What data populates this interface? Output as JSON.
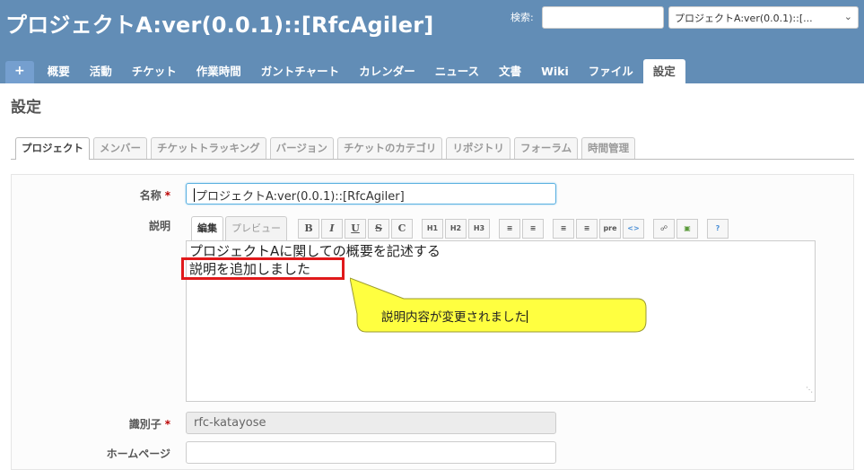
{
  "header": {
    "project_title": "プロジェクトA:ver(0.0.1)::[RfcAgiler]",
    "search_label": "検索:",
    "search_value": "",
    "project_jump": "プロジェクトA:ver(0.0.1)::[..."
  },
  "main_menu": {
    "new": "+",
    "items": [
      "概要",
      "活動",
      "チケット",
      "作業時間",
      "ガントチャート",
      "カレンダー",
      "ニュース",
      "文書",
      "Wiki",
      "ファイル",
      "設定"
    ],
    "selected": "設定"
  },
  "page": {
    "heading": "設定"
  },
  "tabs": {
    "items": [
      "プロジェクト",
      "メンバー",
      "チケットトラッキング",
      "バージョン",
      "チケットのカテゴリ",
      "リポジトリ",
      "フォーラム",
      "時間管理"
    ],
    "selected": "プロジェクト"
  },
  "form": {
    "name_label": "名称",
    "name_value": "プロジェクトA:ver(0.0.1)::[RfcAgiler]",
    "description_label": "説明",
    "editor_tabs": {
      "edit": "編集",
      "preview": "プレビュー"
    },
    "toolbar": [
      "B",
      "I",
      "U",
      "S",
      "C",
      "H1",
      "H2",
      "H3",
      "ul",
      "ol",
      "left",
      "right",
      "pre",
      "code",
      "link",
      "image",
      "help"
    ],
    "description_lines": [
      "プロジェクトAに関しての概要を記述する",
      "説明を追加しました"
    ],
    "identifier_label": "識別子",
    "identifier_value": "rfc-katayose",
    "homepage_label": "ホームページ",
    "homepage_value": "",
    "required_mark": "*"
  },
  "annotation": {
    "callout_text": "説明内容が変更されました",
    "highlight_color": "#e0191b",
    "callout_color": "#ffff40"
  },
  "colors": {
    "header_bg": "#628db6",
    "accent": "#5ab0e0"
  }
}
